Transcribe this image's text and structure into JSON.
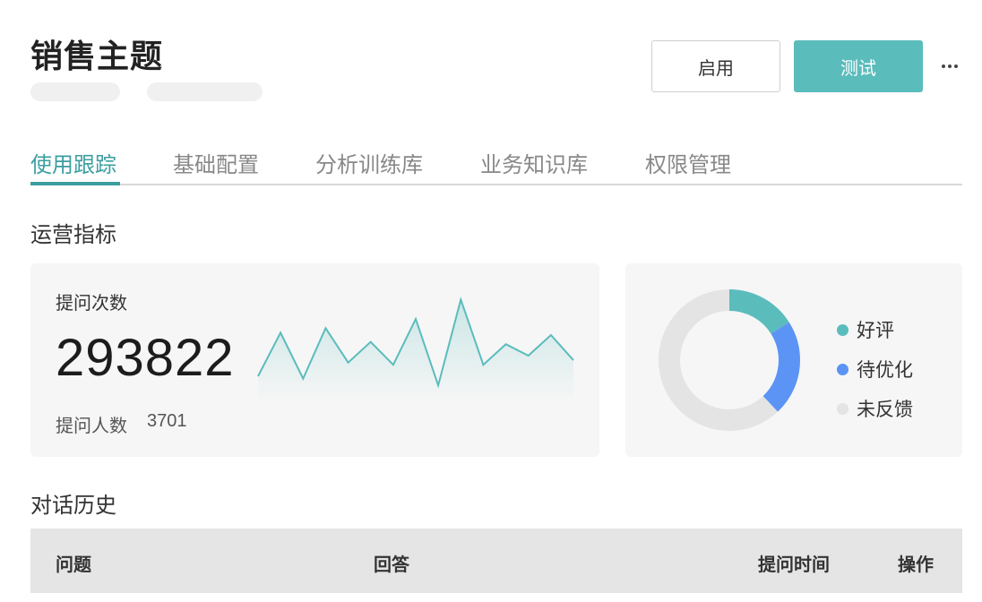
{
  "page": {
    "title": "销售主题"
  },
  "actions": {
    "enable_label": "启用",
    "test_label": "测试"
  },
  "tabs": [
    {
      "label": "使用跟踪",
      "active": true
    },
    {
      "label": "基础配置",
      "active": false
    },
    {
      "label": "分析训练库",
      "active": false
    },
    {
      "label": "业务知识库",
      "active": false
    },
    {
      "label": "权限管理",
      "active": false
    }
  ],
  "sections": {
    "metrics_title": "运营指标",
    "history_title": "对话历史"
  },
  "metrics": {
    "questions_label": "提问次数",
    "questions_value": "293822",
    "askers_label": "提问人数",
    "askers_value": "3701"
  },
  "colors": {
    "accent": "#5bbcbc",
    "tab_active": "#3c9ea0",
    "optimize": "#5b94f5",
    "no_feedback": "#e4e4e4"
  },
  "feedback": {
    "legend": [
      {
        "label": "好评",
        "color": "#5bbcbc",
        "share": 0.16
      },
      {
        "label": "待优化",
        "color": "#5b94f5",
        "share": 0.22
      },
      {
        "label": "未反馈",
        "color": "#e4e4e4",
        "share": 0.62
      }
    ]
  },
  "trend": {
    "values": [
      48,
      86,
      46,
      90,
      60,
      78,
      58,
      98,
      40,
      115,
      58,
      76,
      66,
      84,
      62
    ]
  },
  "table": {
    "columns": [
      "问题",
      "回答",
      "提问时间",
      "操作"
    ]
  }
}
